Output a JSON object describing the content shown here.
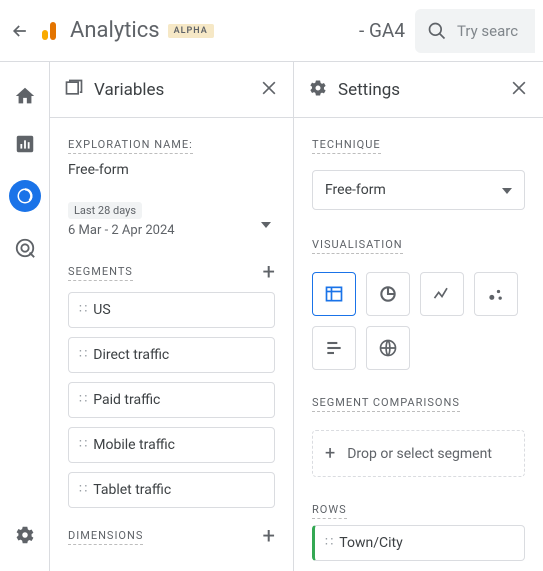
{
  "header": {
    "app_title": "Analytics",
    "badge": "ALPHA",
    "property": "- GA4",
    "search_placeholder": "Try searc"
  },
  "variables": {
    "title": "Variables",
    "exploration_label": "EXPLORATION NAME:",
    "exploration_name": "Free-form",
    "date_pill": "Last 28 days",
    "date_range": "6 Mar - 2 Apr 2024",
    "segments_label": "SEGMENTS",
    "segments": [
      "US",
      "Direct traffic",
      "Paid traffic",
      "Mobile traffic",
      "Tablet traffic"
    ],
    "dimensions_label": "DIMENSIONS"
  },
  "settings": {
    "title": "Settings",
    "technique_label": "TECHNIQUE",
    "technique_value": "Free-form",
    "viz_label": "VISUALISATION",
    "seg_comp_label": "SEGMENT COMPARISONS",
    "dropzone_text": "Drop or select segment",
    "rows_label": "ROWS",
    "rows": [
      "Town/City"
    ]
  }
}
